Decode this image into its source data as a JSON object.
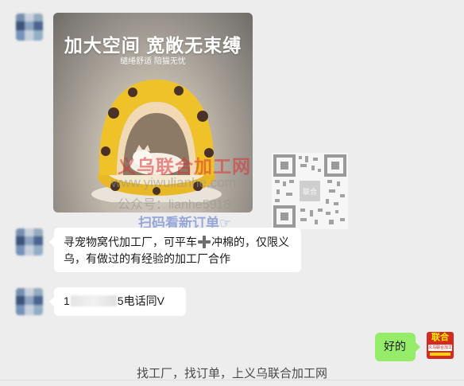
{
  "chat": {
    "product_image": {
      "title": "加大空间 宽敞无束缚",
      "subtitle": "缱绻舒适 陪猫无忧"
    },
    "watermark": {
      "site_name": "义乌联合加工网",
      "url": "www.yiwulianhe.com",
      "wechat": "公众号：lianhe5918",
      "scan_prompt": "扫码看新订单☞",
      "qr_center_label": "联合"
    },
    "messages": [
      {
        "sender": "other",
        "text": "寻宠物窝代加工厂，可平车",
        "text_after_icon_line1": "冲棉的，仅限义",
        "text_line2": "乌，有做过的有经验的加工厂合作",
        "icon": "plus-icon"
      },
      {
        "sender": "other",
        "prefix": "1",
        "suffix": "5电话同V"
      },
      {
        "sender": "self",
        "text": "好的"
      }
    ],
    "self_avatar": {
      "logo_text": "联合",
      "logo_sub": "义乌联合加工网"
    },
    "footer": "找工厂，找订单，上义乌联合加工网"
  },
  "colors": {
    "background": "#ededed",
    "bubble_other": "#ffffff",
    "bubble_self": "#95ec69",
    "logo_red": "#d42a1f",
    "watermark_red": "#da3232",
    "watermark_blue": "#506ec8"
  }
}
